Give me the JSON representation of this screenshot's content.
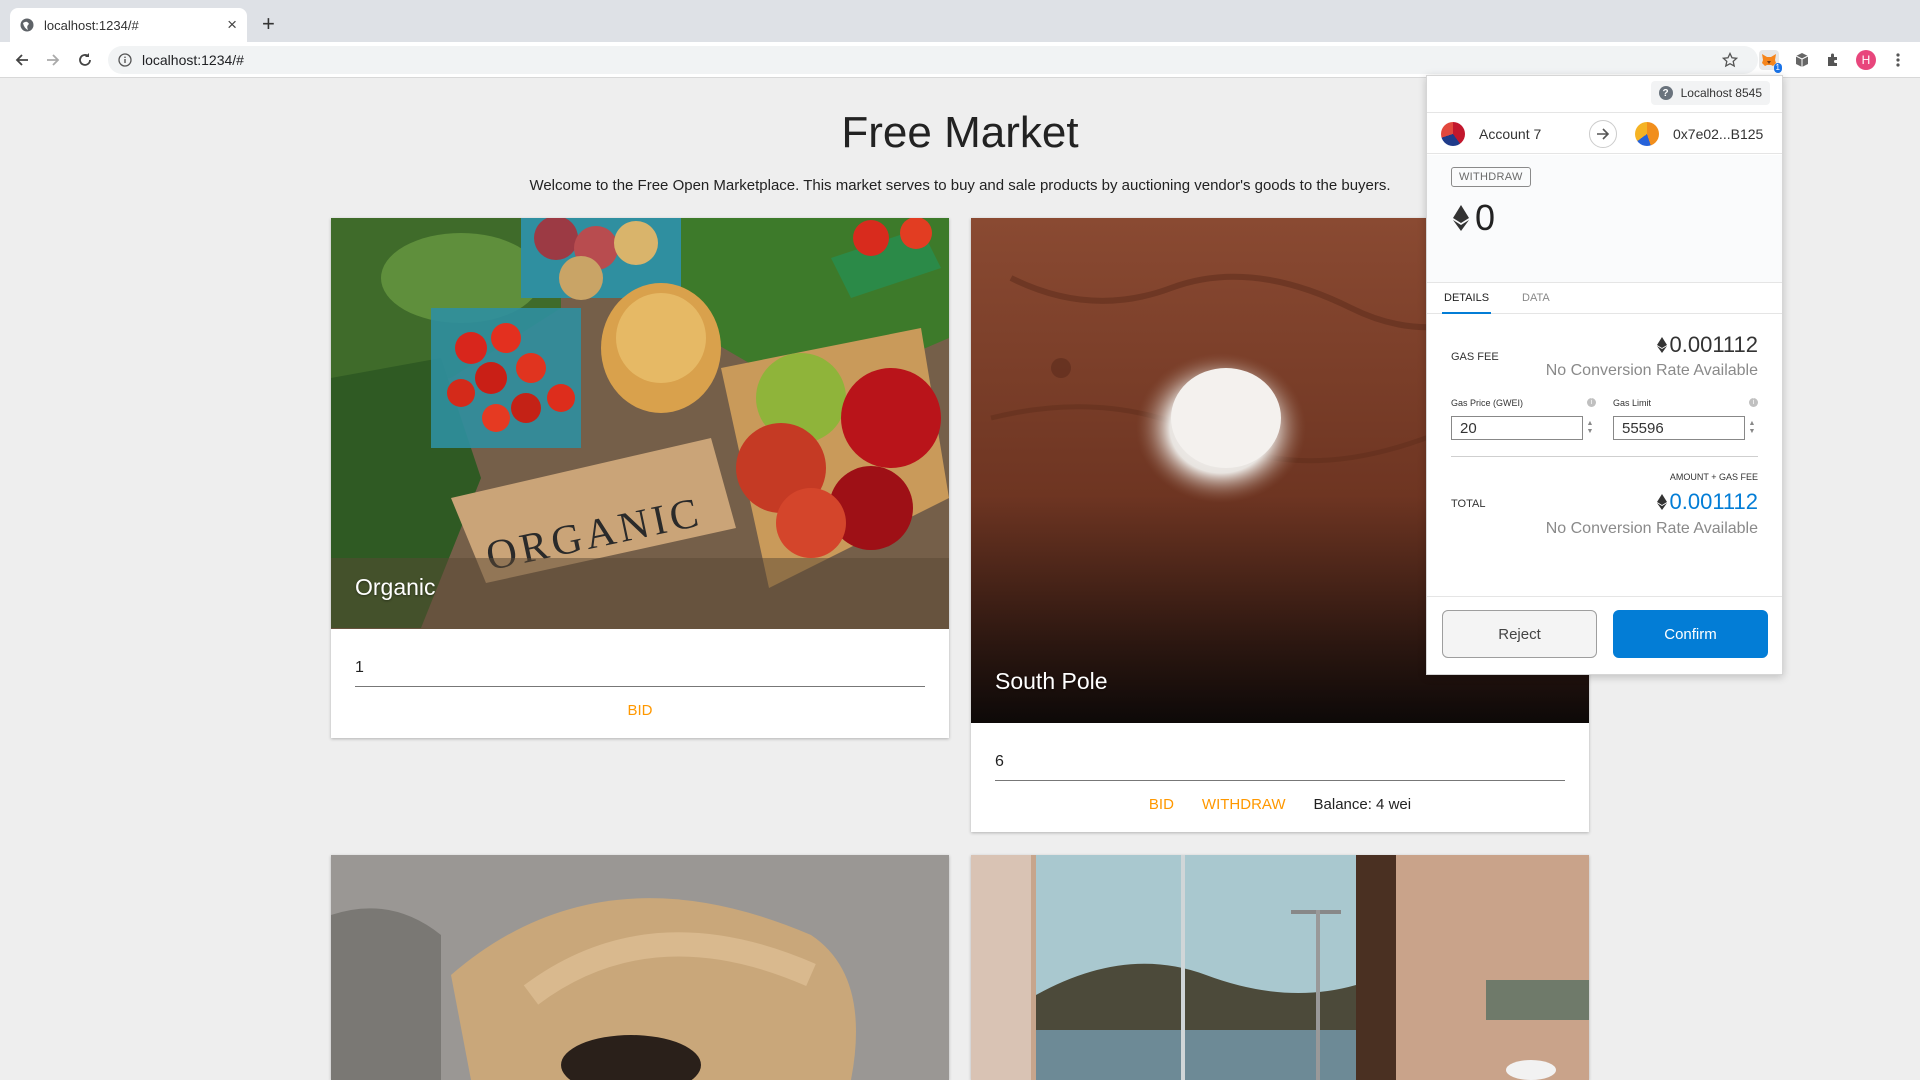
{
  "browser": {
    "tab_title": "localhost:1234/#",
    "new_tab": "+",
    "url": "localhost:1234/#",
    "extension_badge": "1",
    "profile_initial": "H"
  },
  "page": {
    "title": "Free Market",
    "subtitle": "Welcome to the Free Open Marketplace. This market serves to buy and sale products by auctioning vendor's goods to the buyers."
  },
  "cards": [
    {
      "title": "Organic",
      "value": "1",
      "bid_label": "BID"
    },
    {
      "title": "South Pole",
      "value": "6",
      "bid_label": "BID",
      "withdraw_label": "WITHDRAW",
      "balance": "Balance: 4 wei"
    }
  ],
  "metamask": {
    "network": "Localhost 8545",
    "from_account": "Account 7",
    "to_address": "0x7e02...B125",
    "method": "WITHDRAW",
    "amount": "0",
    "tabs": [
      "DETAILS",
      "DATA"
    ],
    "gas_fee_label": "GAS FEE",
    "gas_fee_value": "0.001112",
    "gas_fee_conversion": "No Conversion Rate Available",
    "gas_price_label": "Gas Price (GWEI)",
    "gas_price_value": "20",
    "gas_limit_label": "Gas Limit",
    "gas_limit_value": "55596",
    "total_caption": "AMOUNT + GAS FEE",
    "total_label": "TOTAL",
    "total_value": "0.001112",
    "total_conversion": "No Conversion Rate Available",
    "reject_label": "Reject",
    "confirm_label": "Confirm",
    "colors": {
      "accent": "#037dd6",
      "bid_orange": "#ff9800"
    }
  }
}
